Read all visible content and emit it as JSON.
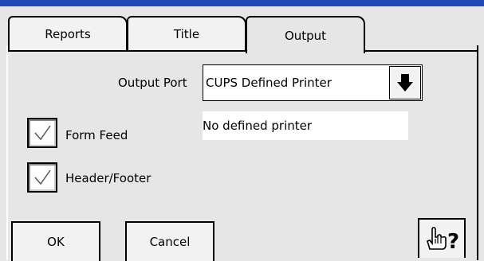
{
  "tabs": [
    {
      "label": "Reports",
      "active": false
    },
    {
      "label": "Title",
      "active": false
    },
    {
      "label": "Output",
      "active": true
    }
  ],
  "output_port": {
    "label": "Output Port",
    "value": "CUPS Defined Printer",
    "dropdown_icon": "arrow-down-icon"
  },
  "printer_status": "No defined printer",
  "form_feed": {
    "label": "Form Feed",
    "checked": true
  },
  "header_footer": {
    "label": "Header/Footer",
    "checked": true
  },
  "buttons": {
    "ok": "OK",
    "cancel": "Cancel",
    "help_icon": "hand-question-help-icon"
  },
  "colors": {
    "title_bar": "#1e49b4",
    "background": "#e6e6e6",
    "field": "#ffffff"
  }
}
